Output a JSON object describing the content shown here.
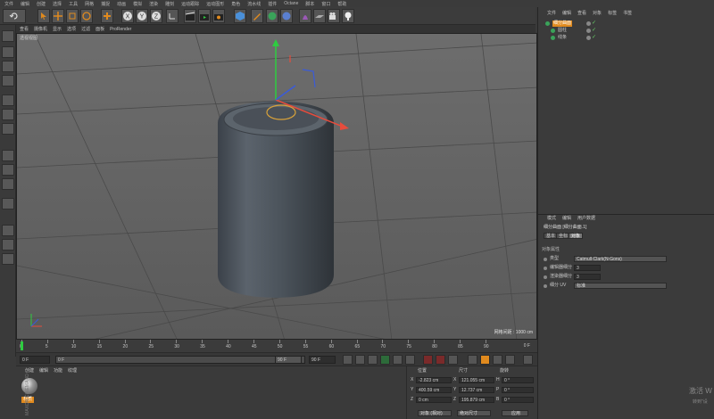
{
  "menubar": [
    "文件",
    "编辑",
    "创建",
    "选择",
    "工具",
    "网格",
    "捕捉",
    "动画",
    "模拟",
    "渲染",
    "雕刻",
    "运动跟踪",
    "运动图形",
    "角色",
    "流水线",
    "插件",
    "Octane",
    "脚本",
    "窗口",
    "帮助"
  ],
  "viewport_menu": [
    "查看",
    "摄像机",
    "显示",
    "选项",
    "过滤",
    "面板",
    "ProRender"
  ],
  "viewport_label": "透视视图",
  "grid_spacing": "网格间距 : 1000 cm",
  "timeline_ticks": [
    "0",
    "5",
    "10",
    "15",
    "20",
    "25",
    "30",
    "35",
    "40",
    "45",
    "50",
    "55",
    "60",
    "65",
    "70",
    "75",
    "80",
    "85",
    "90"
  ],
  "timeline_end": "0 F",
  "transport": {
    "current": "0 F",
    "start": "0 F",
    "end": "90 F",
    "end2": "90 F"
  },
  "material_menu": [
    "创建",
    "编辑",
    "功能",
    "纹理"
  ],
  "material_name": "材质",
  "coords": {
    "headers": [
      "位置",
      "尺寸",
      "旋转"
    ],
    "rows": [
      {
        "axis": "X",
        "pos": "-2.823 cm",
        "size_axis": "X",
        "size": "121.055 cm",
        "rot_axis": "H",
        "rot": "0 °"
      },
      {
        "axis": "Y",
        "pos": "400.59 cm",
        "size_axis": "Y",
        "size": "12.737 cm",
        "rot_axis": "P",
        "rot": "0 °"
      },
      {
        "axis": "Z",
        "pos": "0 cm",
        "size_axis": "Z",
        "size": "195.879 cm",
        "rot_axis": "B",
        "rot": "0 °"
      }
    ],
    "mode1": "对象 (相对)",
    "mode2": "绝对尺寸",
    "apply": "应用"
  },
  "object_panel": {
    "menu": [
      "文件",
      "编辑",
      "查看",
      "对象",
      "标签",
      "书签"
    ],
    "objects": [
      {
        "name": "细分曲面"
      },
      {
        "name": "圆柱"
      },
      {
        "name": "线条"
      }
    ]
  },
  "attr_panel": {
    "menu": [
      "模式",
      "编辑",
      "用户数据"
    ],
    "title": "细分曲面 [细分曲面.1]",
    "tabs": [
      "基本",
      "坐标",
      "对象"
    ],
    "section": "对象属性",
    "props": [
      {
        "label": "类型",
        "value": "Catmull-Clark(N-Gons)",
        "kind": "dropdown"
      },
      {
        "label": "编辑器细分",
        "value": "3",
        "kind": "input"
      },
      {
        "label": "渲染器细分",
        "value": "3",
        "kind": "input"
      },
      {
        "label": "细分 UV",
        "value": "标准",
        "kind": "dropdown"
      }
    ]
  },
  "watermark": {
    "line1": "激活 W",
    "line2": "转到\"设"
  },
  "side_label": "MAXON CINEMA 4D",
  "colors": {
    "accent": "#e08a1e",
    "bg": "#3a3a3a",
    "axis_y": "#2ecc40",
    "axis_x": "#e74c3c",
    "axis_z": "#3a5bd9"
  }
}
